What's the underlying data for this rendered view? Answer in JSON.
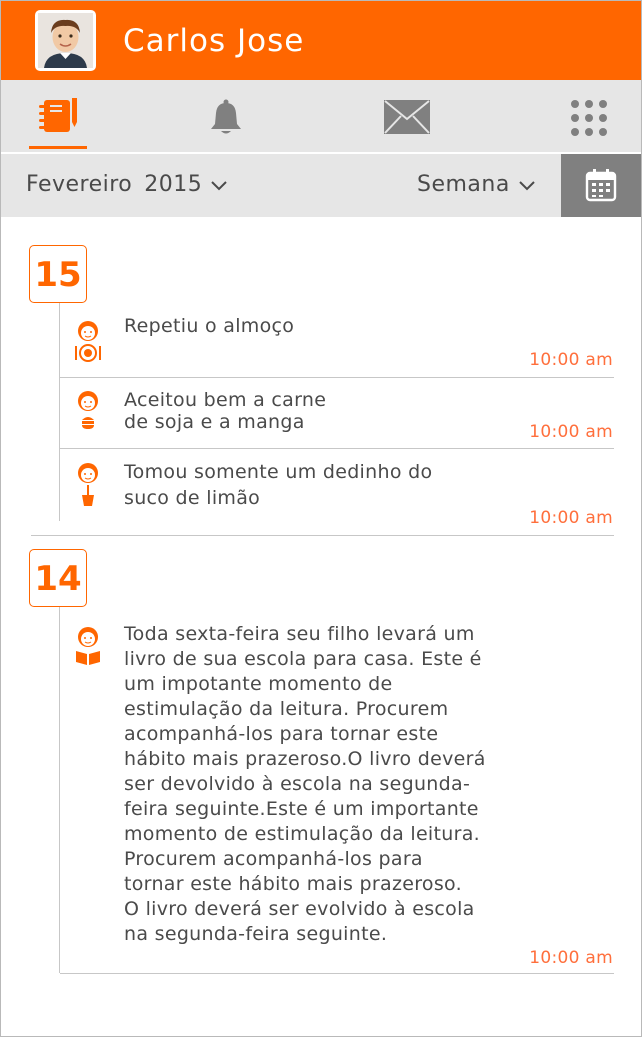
{
  "header": {
    "user_name": "Carlos Jose"
  },
  "nav": {
    "items": [
      {
        "icon": "agenda-notebook-icon",
        "active": true
      },
      {
        "icon": "bell-icon",
        "active": false
      },
      {
        "icon": "envelope-icon",
        "active": false
      },
      {
        "icon": "apps-grid-icon",
        "active": false
      }
    ]
  },
  "filter": {
    "month": "Fevereiro",
    "year": "2015",
    "view": "Semana",
    "calendar_icon": "calendar-icon"
  },
  "colors": {
    "accent": "#ff6600",
    "time": "#ff6f3c",
    "bar": "#e6e6e6",
    "calendar_button": "#808080"
  },
  "days": [
    {
      "day": "15",
      "entries": [
        {
          "icon": "child-meal-icon",
          "lines": [
            "Repetiu o almoço"
          ],
          "time": "10:00 am"
        },
        {
          "icon": "child-food-icon",
          "lines": [
            "Aceitou bem a carne",
            "de soja e a manga"
          ],
          "time": "10:00 am"
        },
        {
          "icon": "child-drink-icon",
          "lines": [
            "Tomou somente um dedinho do",
            "suco de limão"
          ],
          "time": "10:00 am"
        }
      ]
    },
    {
      "day": "14",
      "entries": [
        {
          "icon": "child-reading-icon",
          "lines": [
            "Toda sexta-feira seu filho levará um",
            "livro de sua escola para casa. Este é",
            "um impotante momento de",
            "estimulação da leitura. Procurem",
            "acompanhá-los para tornar este",
            "hábito mais prazeroso.O livro deverá",
            "ser devolvido à escola na segunda-",
            "feira seguinte.Este é um importante",
            "momento de estimulação da leitura.",
            "Procurem acompanhá-los para",
            "tornar este hábito mais prazeroso.",
            "O livro deverá ser evolvido à escola",
            "na segunda-feira seguinte."
          ],
          "time": "10:00 am"
        }
      ]
    }
  ]
}
